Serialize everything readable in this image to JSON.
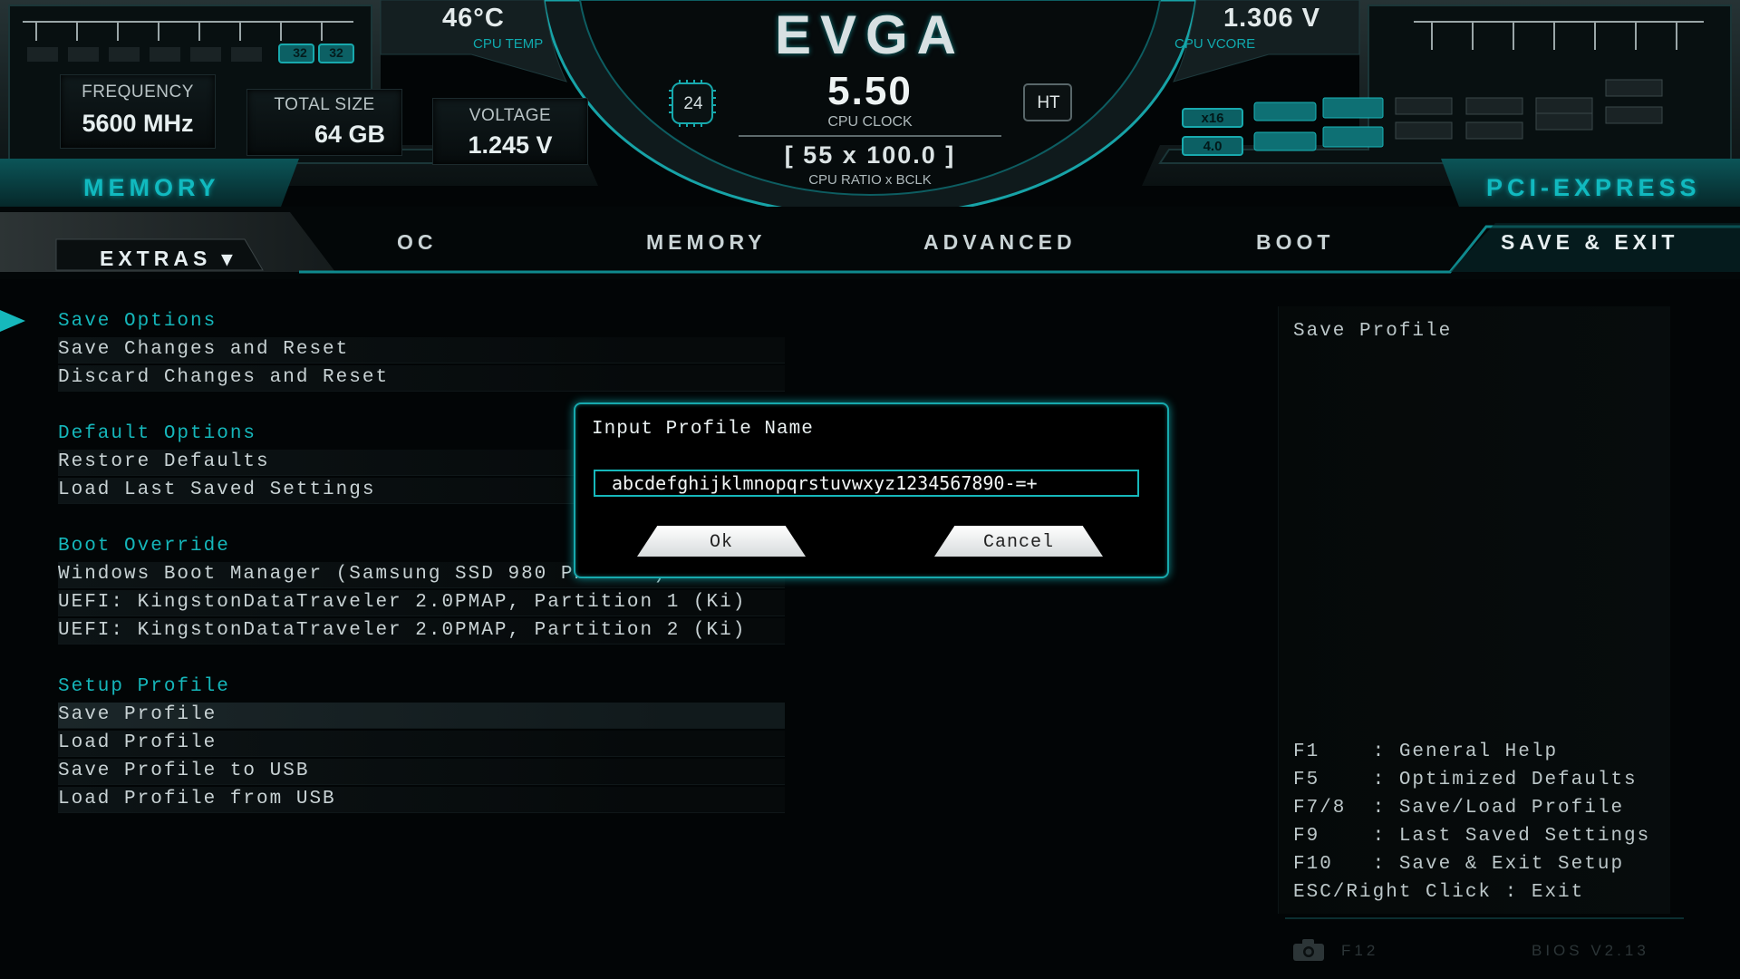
{
  "header": {
    "logo": "EVGA",
    "cpu_temp": {
      "value": "46°C",
      "label": "CPU TEMP"
    },
    "cpu_vcore": {
      "value": "1.306 V",
      "label": "CPU VCORE"
    },
    "cpu_clock": {
      "value": "5.50",
      "label": "CPU CLOCK"
    },
    "cpu_ratio": {
      "value": "[ 55 x 100.0 ]",
      "label": "CPU RATIO x BCLK"
    },
    "cores": "24",
    "ht": "HT",
    "memory": {
      "title": "MEMORY",
      "frequency": {
        "label": "FREQUENCY",
        "value": "5600 MHz"
      },
      "total_size": {
        "label": "TOTAL SIZE",
        "value": "64 GB"
      },
      "voltage": {
        "label": "VOLTAGE",
        "value": "1.245 V"
      },
      "slot_badges": [
        "32",
        "32"
      ]
    },
    "pcie": {
      "title": "PCI-EXPRESS",
      "lanes": "x16",
      "gen": "4.0"
    }
  },
  "tabs": {
    "extras": "EXTRAS ▾",
    "items": [
      "OC",
      "MEMORY",
      "ADVANCED",
      "BOOT",
      "SAVE & EXIT"
    ]
  },
  "menu": {
    "save_options": "Save Options",
    "save_changes_reset": "Save Changes and Reset",
    "discard_changes_reset": "Discard Changes and Reset",
    "default_options": "Default Options",
    "restore_defaults": "Restore Defaults",
    "load_last_saved": "Load Last Saved Settings",
    "boot_override": "Boot Override",
    "boot_windows": "Windows Boot Manager (Samsung SSD 980 PRO 2TB)",
    "boot_usb1": "UEFI: KingstonDataTraveler 2.0PMAP, Partition 1 (Ki)",
    "boot_usb2": "UEFI: KingstonDataTraveler 2.0PMAP, Partition 2 (Ki)",
    "setup_profile": "Setup Profile",
    "save_profile": "Save Profile",
    "load_profile": "Load Profile",
    "save_profile_usb": "Save Profile to USB",
    "load_profile_usb": "Load Profile from USB"
  },
  "help": {
    "description": "Save Profile",
    "keys": [
      "F1    : General Help",
      "F5    : Optimized Defaults",
      "F7/8  : Save/Load Profile",
      "F9    : Last Saved Settings",
      "F10   : Save & Exit Setup",
      "ESC/Right Click : Exit"
    ],
    "screenshot_key": "F12",
    "bios_version": "BIOS V2.13"
  },
  "dialog": {
    "title": "Input Profile Name",
    "input_value": "abcdefghijklmnopqrstuvwxyz1234567890-=+",
    "ok": "Ok",
    "cancel": "Cancel"
  },
  "colors": {
    "accent": "#16b8bc",
    "background": "#020506",
    "text": "#c8d2d4"
  }
}
